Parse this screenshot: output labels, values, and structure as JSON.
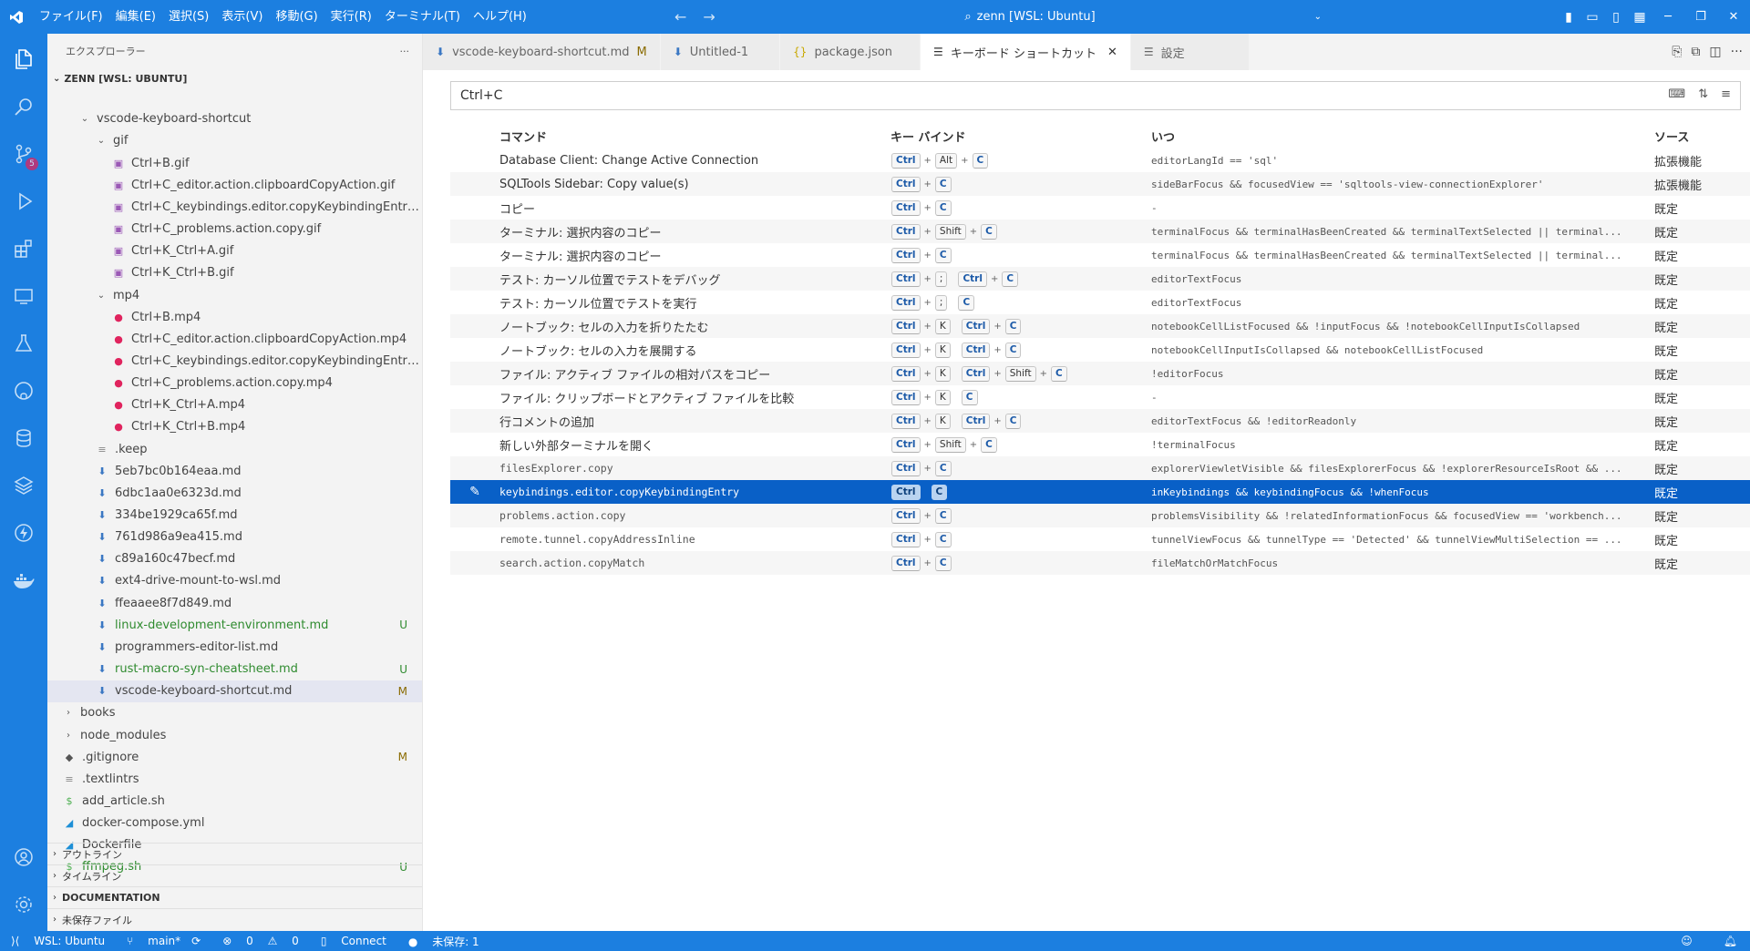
{
  "titlebar": {
    "menu": [
      "ファイル(F)",
      "編集(E)",
      "選択(S)",
      "表示(V)",
      "移動(G)",
      "実行(R)",
      "ターミナル(T)",
      "ヘルプ(H)"
    ],
    "search_text": "zenn [WSL: Ubuntu]"
  },
  "activitybar": {
    "scm_badge": "5"
  },
  "explorer": {
    "header": "エクスプローラー",
    "root": "ZENN [WSL: UBUNTU]",
    "items": [
      {
        "name": "vscode-keyboard-shortcut",
        "type": "folder-open",
        "depth": 1,
        "status": ""
      },
      {
        "name": "gif",
        "type": "folder-open",
        "depth": 2,
        "status": ""
      },
      {
        "name": "Ctrl+B.gif",
        "type": "image",
        "depth": 3,
        "status": ""
      },
      {
        "name": "Ctrl+C_editor.action.clipboardCopyAction.gif",
        "type": "image",
        "depth": 3,
        "status": ""
      },
      {
        "name": "Ctrl+C_keybindings.editor.copyKeybindingEntry....",
        "type": "image",
        "depth": 3,
        "status": ""
      },
      {
        "name": "Ctrl+C_problems.action.copy.gif",
        "type": "image",
        "depth": 3,
        "status": ""
      },
      {
        "name": "Ctrl+K_Ctrl+A.gif",
        "type": "image",
        "depth": 3,
        "status": ""
      },
      {
        "name": "Ctrl+K_Ctrl+B.gif",
        "type": "image",
        "depth": 3,
        "status": ""
      },
      {
        "name": "mp4",
        "type": "folder-open",
        "depth": 2,
        "status": ""
      },
      {
        "name": "Ctrl+B.mp4",
        "type": "video",
        "depth": 3,
        "status": ""
      },
      {
        "name": "Ctrl+C_editor.action.clipboardCopyAction.mp4",
        "type": "video",
        "depth": 3,
        "status": ""
      },
      {
        "name": "Ctrl+C_keybindings.editor.copyKeybindingEntry....",
        "type": "video",
        "depth": 3,
        "status": ""
      },
      {
        "name": "Ctrl+C_problems.action.copy.mp4",
        "type": "video",
        "depth": 3,
        "status": ""
      },
      {
        "name": "Ctrl+K_Ctrl+A.mp4",
        "type": "video",
        "depth": 3,
        "status": ""
      },
      {
        "name": "Ctrl+K_Ctrl+B.mp4",
        "type": "video",
        "depth": 3,
        "status": ""
      },
      {
        "name": ".keep",
        "type": "text",
        "depth": 2,
        "status": ""
      },
      {
        "name": "5eb7bc0b164eaa.md",
        "type": "markdown",
        "depth": 2,
        "status": ""
      },
      {
        "name": "6dbc1aa0e6323d.md",
        "type": "markdown",
        "depth": 2,
        "status": ""
      },
      {
        "name": "334be1929ca65f.md",
        "type": "markdown",
        "depth": 2,
        "status": ""
      },
      {
        "name": "761d986a9ea415.md",
        "type": "markdown",
        "depth": 2,
        "status": ""
      },
      {
        "name": "c89a160c47becf.md",
        "type": "markdown",
        "depth": 2,
        "status": ""
      },
      {
        "name": "ext4-drive-mount-to-wsl.md",
        "type": "markdown",
        "depth": 2,
        "status": ""
      },
      {
        "name": "ffeaaee8f7d849.md",
        "type": "markdown",
        "depth": 2,
        "status": ""
      },
      {
        "name": "linux-development-environment.md",
        "type": "markdown",
        "depth": 2,
        "status": "U"
      },
      {
        "name": "programmers-editor-list.md",
        "type": "markdown",
        "depth": 2,
        "status": ""
      },
      {
        "name": "rust-macro-syn-cheatsheet.md",
        "type": "markdown",
        "depth": 2,
        "status": "U"
      },
      {
        "name": "vscode-keyboard-shortcut.md",
        "type": "markdown",
        "depth": 2,
        "status": "M"
      },
      {
        "name": "books",
        "type": "folder",
        "depth": 0,
        "status": ""
      },
      {
        "name": "node_modules",
        "type": "folder",
        "depth": 0,
        "status": ""
      },
      {
        "name": ".gitignore",
        "type": "git",
        "depth": 0,
        "status": "M"
      },
      {
        "name": ".textlintrs",
        "type": "text",
        "depth": 0,
        "status": ""
      },
      {
        "name": "add_article.sh",
        "type": "shell",
        "depth": 0,
        "status": ""
      },
      {
        "name": "docker-compose.yml",
        "type": "docker",
        "depth": 0,
        "status": ""
      },
      {
        "name": "Dockerfile",
        "type": "docker",
        "depth": 0,
        "status": ""
      },
      {
        "name": "ffmpeg.sh",
        "type": "shell",
        "depth": 0,
        "status": "U"
      }
    ],
    "sections": [
      "アウトライン",
      "タイムライン",
      "DOCUMENTATION",
      "未保存ファイル"
    ]
  },
  "tabs": [
    {
      "label": "vscode-keyboard-shortcut.md",
      "icon": "md",
      "status": "M"
    },
    {
      "label": "Untitled-1",
      "icon": "md",
      "status": ""
    },
    {
      "label": "package.json",
      "icon": "json",
      "status": ""
    },
    {
      "label": "キーボード ショートカット",
      "icon": "list",
      "status": ""
    },
    {
      "label": "設定",
      "icon": "list",
      "status": ""
    }
  ],
  "keybindings": {
    "search_value": "Ctrl+C",
    "headers": {
      "command": "コマンド",
      "keybinding": "キー バインド",
      "when": "いつ",
      "source": "ソース"
    },
    "rows": [
      {
        "command": "Database Client: Change Active Connection",
        "mono": false,
        "keys": [
          [
            "Ctrl",
            "Alt",
            "C"
          ]
        ],
        "when": "editorLangId == 'sql'",
        "source": "拡張機能"
      },
      {
        "command": "SQLTools Sidebar: Copy value(s)",
        "mono": false,
        "keys": [
          [
            "Ctrl",
            "C"
          ]
        ],
        "when": "sideBarFocus && focusedView == 'sqltools-view-connectionExplorer'",
        "source": "拡張機能"
      },
      {
        "command": "コピー",
        "mono": false,
        "keys": [
          [
            "Ctrl",
            "C"
          ]
        ],
        "when": "-",
        "source": "既定"
      },
      {
        "command": "ターミナル: 選択内容のコピー",
        "mono": false,
        "keys": [
          [
            "Ctrl",
            "Shift",
            "C"
          ]
        ],
        "when": "terminalFocus && terminalHasBeenCreated && terminalTextSelected || terminal...",
        "source": "既定"
      },
      {
        "command": "ターミナル: 選択内容のコピー",
        "mono": false,
        "keys": [
          [
            "Ctrl",
            "C"
          ]
        ],
        "when": "terminalFocus && terminalHasBeenCreated && terminalTextSelected || terminal...",
        "source": "既定"
      },
      {
        "command": "テスト: カーソル位置でテストをデバッグ",
        "mono": false,
        "keys": [
          [
            "Ctrl",
            ";"
          ],
          [
            "Ctrl",
            "C"
          ]
        ],
        "when": "editorTextFocus",
        "source": "既定"
      },
      {
        "command": "テスト: カーソル位置でテストを実行",
        "mono": false,
        "keys": [
          [
            "Ctrl",
            ";"
          ],
          [
            "C"
          ]
        ],
        "when": "editorTextFocus",
        "source": "既定"
      },
      {
        "command": "ノートブック: セルの入力を折りたたむ",
        "mono": false,
        "keys": [
          [
            "Ctrl",
            "K"
          ],
          [
            "Ctrl",
            "C"
          ]
        ],
        "when": "notebookCellListFocused && !inputFocus && !notebookCellInputIsCollapsed",
        "source": "既定"
      },
      {
        "command": "ノートブック: セルの入力を展開する",
        "mono": false,
        "keys": [
          [
            "Ctrl",
            "K"
          ],
          [
            "Ctrl",
            "C"
          ]
        ],
        "when": "notebookCellInputIsCollapsed && notebookCellListFocused",
        "source": "既定"
      },
      {
        "command": "ファイル: アクティブ ファイルの相対パスをコピー",
        "mono": false,
        "keys": [
          [
            "Ctrl",
            "K"
          ],
          [
            "Ctrl",
            "Shift",
            "C"
          ]
        ],
        "when": "!editorFocus",
        "source": "既定"
      },
      {
        "command": "ファイル: クリップボードとアクティブ ファイルを比較",
        "mono": false,
        "keys": [
          [
            "Ctrl",
            "K"
          ],
          [
            "C"
          ]
        ],
        "when": "-",
        "source": "既定"
      },
      {
        "command": "行コメントの追加",
        "mono": false,
        "keys": [
          [
            "Ctrl",
            "K"
          ],
          [
            "Ctrl",
            "C"
          ]
        ],
        "when": "editorTextFocus && !editorReadonly",
        "source": "既定"
      },
      {
        "command": "新しい外部ターミナルを開く",
        "mono": false,
        "keys": [
          [
            "Ctrl",
            "Shift",
            "C"
          ]
        ],
        "when": "!terminalFocus",
        "source": "既定"
      },
      {
        "command": "filesExplorer.copy",
        "mono": true,
        "keys": [
          [
            "Ctrl",
            "C"
          ]
        ],
        "when": "explorerViewletVisible && filesExplorerFocus && !explorerResourceIsRoot && ...",
        "source": "既定"
      },
      {
        "command": "keybindings.editor.copyKeybindingEntry",
        "mono": true,
        "keys": [
          [
            "Ctrl"
          ],
          [
            "C"
          ]
        ],
        "when": "inKeybindings && keybindingFocus && !whenFocus",
        "source": "既定",
        "selected": true
      },
      {
        "command": "problems.action.copy",
        "mono": true,
        "keys": [
          [
            "Ctrl",
            "C"
          ]
        ],
        "when": "problemsVisibility && !relatedInformationFocus && focusedView == 'workbench...",
        "source": "既定"
      },
      {
        "command": "remote.tunnel.copyAddressInline",
        "mono": true,
        "keys": [
          [
            "Ctrl",
            "C"
          ]
        ],
        "when": "tunnelViewFocus && tunnelType == 'Detected' && tunnelViewMultiSelection == ...",
        "source": "既定"
      },
      {
        "command": "search.action.copyMatch",
        "mono": true,
        "keys": [
          [
            "Ctrl",
            "C"
          ]
        ],
        "when": "fileMatchOrMatchFocus",
        "source": "既定"
      }
    ]
  },
  "statusbar": {
    "remote": "WSL: Ubuntu",
    "branch": "main*",
    "errors": "0",
    "warnings": "0",
    "connect": "Connect",
    "unsaved": "未保存: 1"
  },
  "colors": {
    "accent": "#1c7fe0",
    "selection": "#0960c7",
    "untracked": "#2f8b2f",
    "modified": "#8a6b00"
  }
}
